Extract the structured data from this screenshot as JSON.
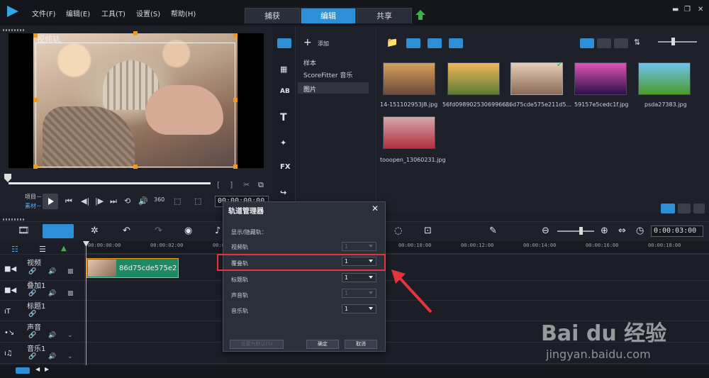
{
  "menu": {
    "file": "文件(F)",
    "edit": "编辑(E)",
    "tools": "工具(T)",
    "settings": "设置(S)",
    "help": "帮助(H)"
  },
  "tabs": {
    "capture": "捕获",
    "edit": "编辑",
    "share": "共享"
  },
  "preview": {
    "track_label": "视频轨",
    "mode_project": "项目－",
    "mode_clip": "素材－",
    "timecode": "00:00:00:00"
  },
  "library": {
    "add_label": "添加",
    "folders": [
      "样本",
      "ScoreFitter 音乐",
      "图片"
    ],
    "thumbnails": [
      {
        "label": "14-151102953J8.jpg",
        "colors": [
          "#d7a15a",
          "#6b4a3a"
        ]
      },
      {
        "label": "56fd09890253069966...",
        "colors": [
          "#f2b85a",
          "#5b7a34"
        ]
      },
      {
        "label": "86d75cde575e211d5...",
        "colors": [
          "#e6cdb5",
          "#8b6b58"
        ]
      },
      {
        "label": "59157e5cedc1f.jpg",
        "colors": [
          "#e055b8",
          "#2a1046"
        ]
      },
      {
        "label": "psda27383.jpg",
        "colors": [
          "#6fc3ef",
          "#4b9a2a"
        ]
      },
      {
        "label": "tooopen_13060231.jpg",
        "colors": [
          "#d2a8a8",
          "#b33040"
        ]
      }
    ]
  },
  "timeline": {
    "timecode": "0:00:03:00",
    "ruler": [
      "00:00:00:00",
      "00:00:02:00",
      "00:00:04:00",
      "00:00:10:00",
      "00:00:12:00",
      "00:00:14:00",
      "00:00:16:00",
      "00:00:18:00"
    ],
    "tracks": {
      "video": "视频",
      "overlay": "叠加1",
      "title": "标题1",
      "voice": "声音",
      "music": "音乐1"
    },
    "clip_label": "86d75cde575e211d5"
  },
  "dialog": {
    "title": "轨道管理器",
    "subtitle": "显示/隐藏轨：",
    "rows": [
      {
        "label": "视频轨",
        "value": "1",
        "enabled": false
      },
      {
        "label": "覆叠轨",
        "value": "1",
        "enabled": true
      },
      {
        "label": "标题轨",
        "value": "1",
        "enabled": true
      },
      {
        "label": "声音轨",
        "value": "1",
        "enabled": false
      },
      {
        "label": "音乐轨",
        "value": "1",
        "enabled": true
      }
    ],
    "set_default": "设置为默认(S)",
    "ok": "确定",
    "cancel": "取消"
  },
  "watermark": {
    "logo": "Bai du 经验",
    "url": "jingyan.baidu.com"
  },
  "colors": {
    "accent": "#2d8fd6",
    "highlight": "#e5343d",
    "clip": "#1d8a63"
  }
}
